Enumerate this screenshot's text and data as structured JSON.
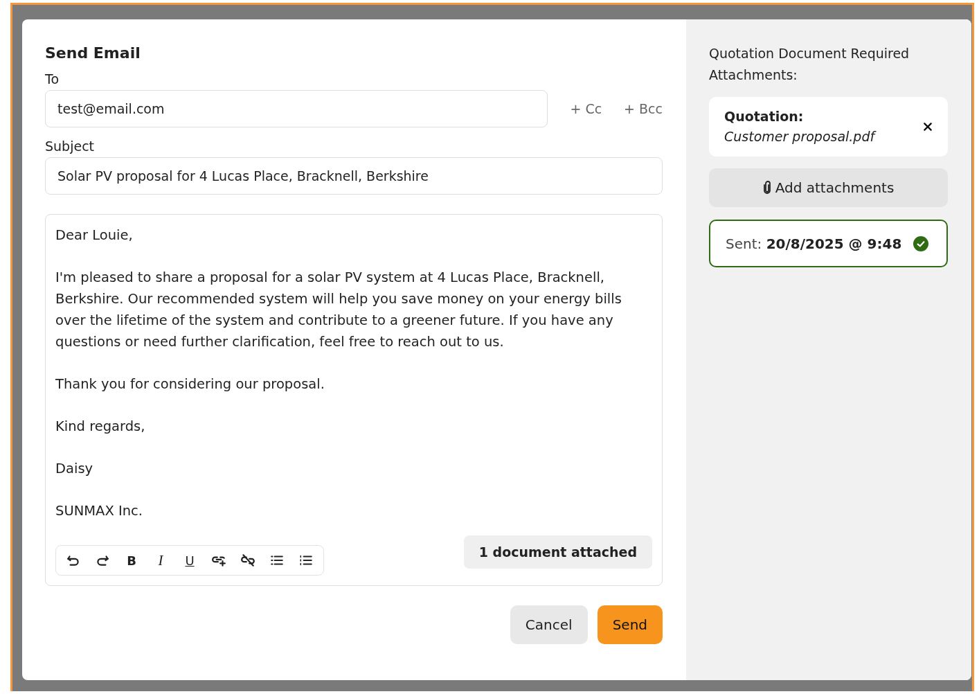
{
  "dialog": {
    "title": "Send Email",
    "to": {
      "label": "To",
      "value": "test@email.com",
      "cc": "+ Cc",
      "bcc": "+ Bcc"
    },
    "subject": {
      "label": "Subject",
      "value": "Solar PV proposal for 4 Lucas Place, Bracknell, Berkshire"
    },
    "message": {
      "paragraphs": [
        "Dear Louie,",
        "I'm pleased to share a proposal for a solar PV system at 4 Lucas Place, Bracknell, Berkshire. Our recommended system will help you save money on your energy bills over the lifetime of the system and contribute to a greener future. If you have any questions or need further clarification, feel free to reach out to us.",
        "Thank you for considering our proposal.",
        "Kind regards,",
        "Daisy",
        "SUNMAX Inc."
      ],
      "toolbar": [
        {
          "kind": "undo"
        },
        {
          "kind": "redo"
        },
        {
          "kind": "bold",
          "label": "B"
        },
        {
          "kind": "italic",
          "label": "I"
        },
        {
          "kind": "underline",
          "label": "U"
        },
        {
          "kind": "link"
        },
        {
          "kind": "unlink"
        },
        {
          "kind": "bullet-list"
        },
        {
          "kind": "numbered-list"
        }
      ],
      "attached": "1 document attached"
    },
    "buttons": [
      {
        "kind": "secondary",
        "label": "Cancel"
      },
      {
        "kind": "primary",
        "label": "Send"
      }
    ]
  },
  "side_panel": {
    "title": "Quotation Document Required Attachments:",
    "attachments": [
      {
        "label": "Quotation:",
        "file": "Customer proposal.pdf"
      }
    ],
    "add_button": "Add attachments",
    "sent": {
      "label": "Sent:",
      "value": "20/8/2025 @ 9:48",
      "confirmed": true
    }
  }
}
